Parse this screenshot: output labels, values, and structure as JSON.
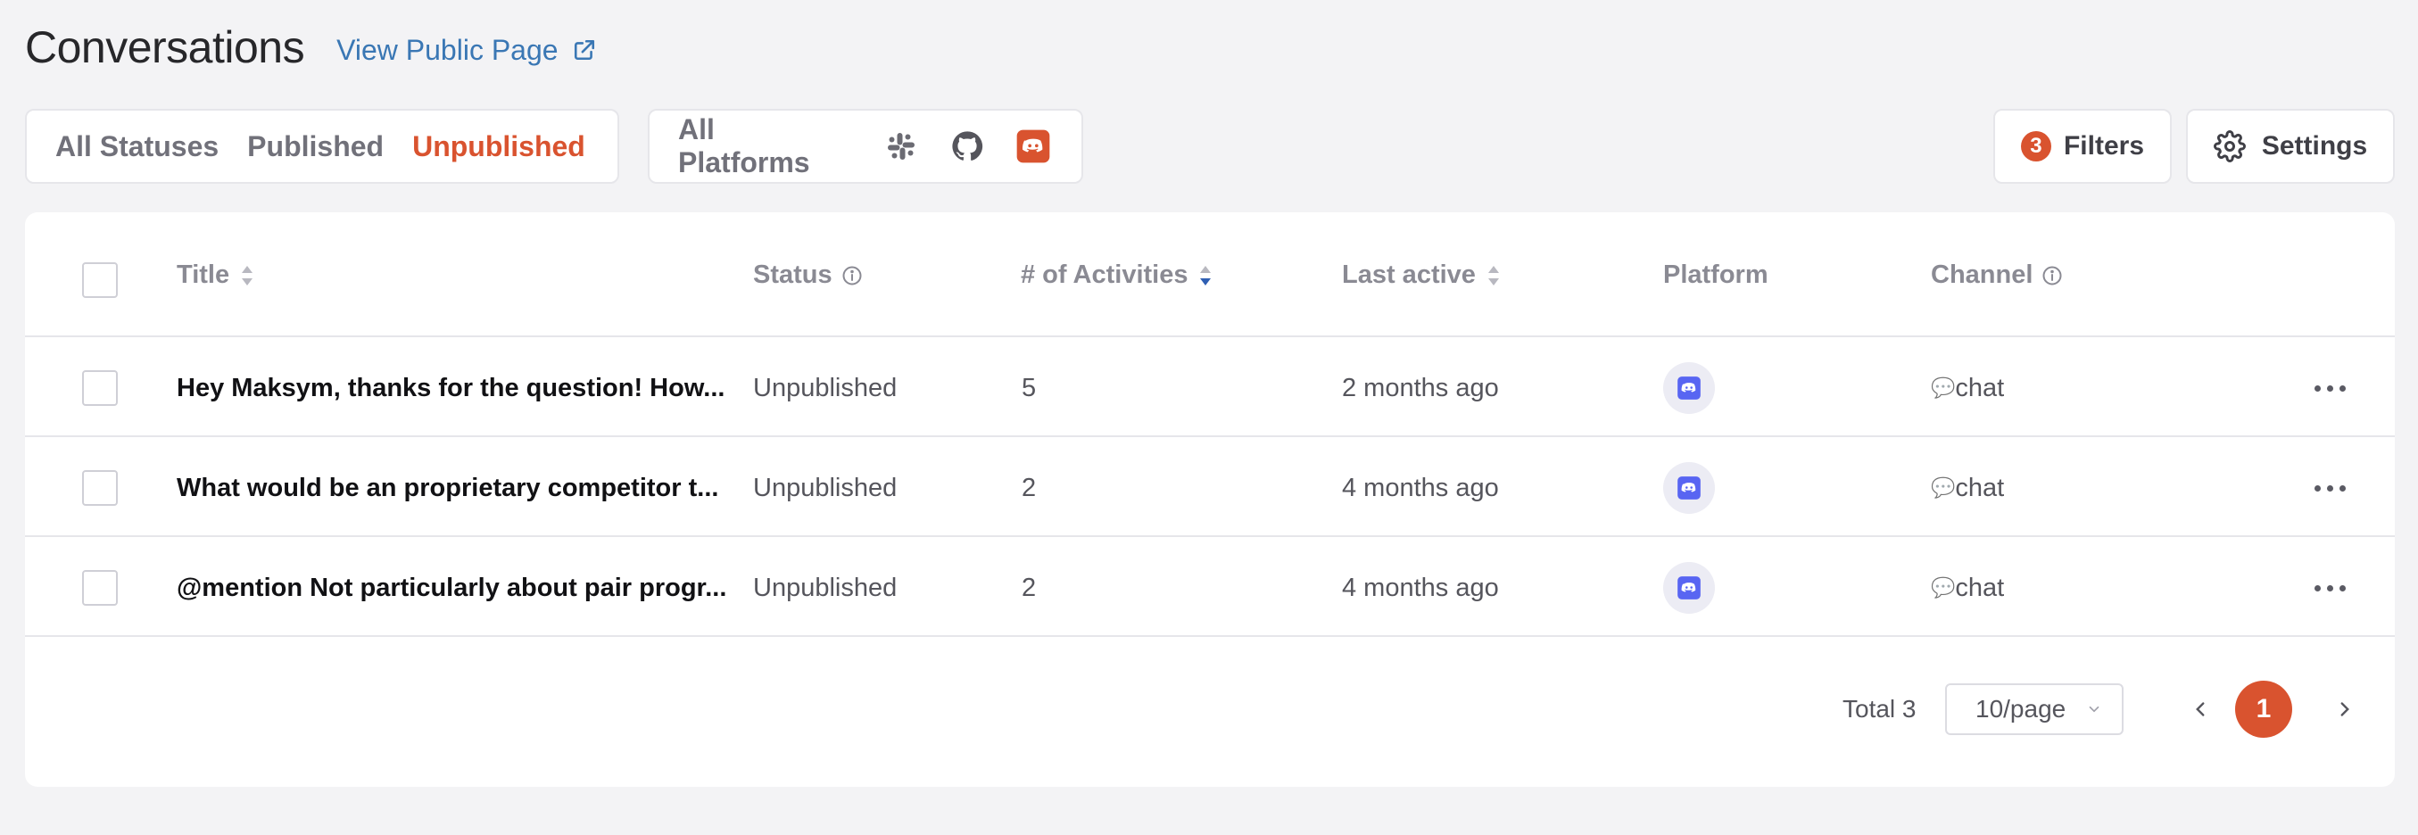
{
  "header": {
    "title": "Conversations",
    "public_link": "View Public Page"
  },
  "status_filter": {
    "options": [
      "All Statuses",
      "Published",
      "Unpublished"
    ],
    "selected": "Unpublished"
  },
  "platform_filter": {
    "label": "All Platforms",
    "icons": [
      "slack-icon",
      "github-icon",
      "discord-icon"
    ],
    "selected_icon": "discord-icon"
  },
  "toolbar": {
    "filters_count": "3",
    "filters_label": "Filters",
    "settings_label": "Settings"
  },
  "table": {
    "columns": {
      "title": "Title",
      "status": "Status",
      "activities": "# of Activities",
      "last_active": "Last active",
      "platform": "Platform",
      "channel": "Channel"
    },
    "sorted_column": "# of Activities",
    "rows": [
      {
        "title": "Hey Maksym, thanks for the question! How...",
        "status": "Unpublished",
        "activities": "5",
        "last_active": "2 months ago",
        "platform": "discord-icon",
        "channel_icon": "💬",
        "channel": "chat"
      },
      {
        "title": "What would be an proprietary competitor t...",
        "status": "Unpublished",
        "activities": "2",
        "last_active": "4 months ago",
        "platform": "discord-icon",
        "channel_icon": "💬",
        "channel": "chat"
      },
      {
        "title": "@mention Not particularly about pair progr...",
        "status": "Unpublished",
        "activities": "2",
        "last_active": "4 months ago",
        "platform": "discord-icon",
        "channel_icon": "💬",
        "channel": "chat"
      }
    ]
  },
  "pagination": {
    "total": "Total 3",
    "page_size": "10/page",
    "current_page": "1"
  },
  "colors": {
    "accent": "#d9532f",
    "link": "#3a77b4",
    "discord": "#5865f2",
    "sort_active": "#2f5fb3"
  }
}
